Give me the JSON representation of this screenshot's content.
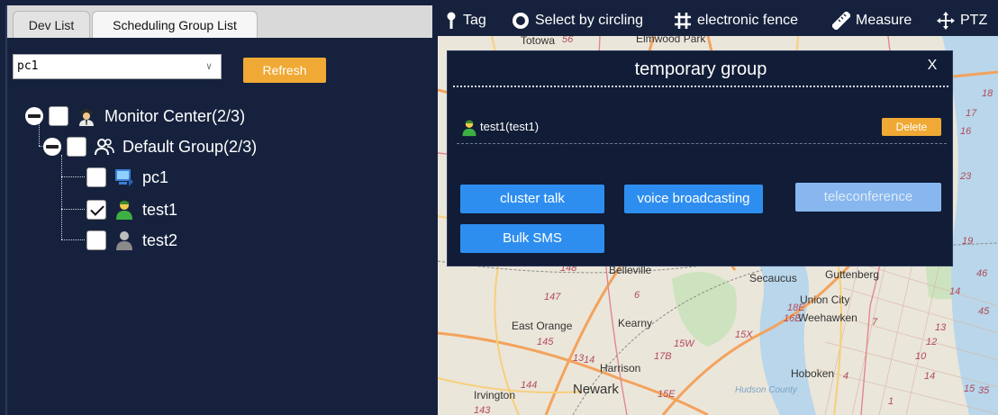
{
  "tabs": [
    {
      "label": "Dev List",
      "active": false
    },
    {
      "label": "Scheduling Group List",
      "active": true
    }
  ],
  "controls": {
    "group_select_value": "pc1",
    "refresh_label": "Refresh"
  },
  "tree": {
    "root": {
      "label": "Monitor Center(2/3)",
      "icon": "person-officer-icon",
      "checked": false
    },
    "group": {
      "label": "Default Group(2/3)",
      "icon": "group-users-icon",
      "checked": false
    },
    "members": [
      {
        "label": "pc1",
        "icon": "pc-monitor-icon",
        "checked": false
      },
      {
        "label": "test1",
        "icon": "user-online-icon",
        "checked": true
      },
      {
        "label": "test2",
        "icon": "user-offline-icon",
        "checked": false
      }
    ]
  },
  "toolbar": [
    {
      "label": "Tag",
      "icon": "pin-icon"
    },
    {
      "label": "Select by circling",
      "icon": "circle-select-icon"
    },
    {
      "label": "electronic fence",
      "icon": "hash-fence-icon"
    },
    {
      "label": "Measure",
      "icon": "ruler-icon"
    },
    {
      "label": "PTZ",
      "icon": "move-arrows-icon"
    }
  ],
  "map_labels": [
    "Totowa",
    "Belleville",
    "Secaucus",
    "Guttenberg",
    "Union City",
    "Weehawken",
    "East Orange",
    "Kearny",
    "Harrison",
    "Hoboken",
    "Newark",
    "Irvington",
    "Hudson County",
    "Elmwood Park"
  ],
  "map_route_numbers": [
    "56",
    "148",
    "147",
    "145",
    "144",
    "143",
    "13",
    "14",
    "15W",
    "17B",
    "15X",
    "18E",
    "16E",
    "15E",
    "18",
    "17",
    "16",
    "23",
    "19",
    "12",
    "10",
    "14",
    "46",
    "45",
    "13",
    "14",
    "15",
    "35",
    "6",
    "7",
    "4",
    "1"
  ],
  "dialog": {
    "title": "temporary group",
    "close_label": "X",
    "member_name": "test1(test1)",
    "delete_label": "Delete",
    "actions": {
      "cluster_talk": "cluster talk",
      "voice_broadcasting": "voice broadcasting",
      "teleconference": "teleconference",
      "bulk_sms": "Bulk SMS"
    }
  },
  "colors": {
    "panel_bg": "#16223d",
    "dialog_bg": "#111c36",
    "accent_orange": "#efa934",
    "action_blue": "#2e8ef0",
    "disabled_blue": "#87b7ee"
  }
}
